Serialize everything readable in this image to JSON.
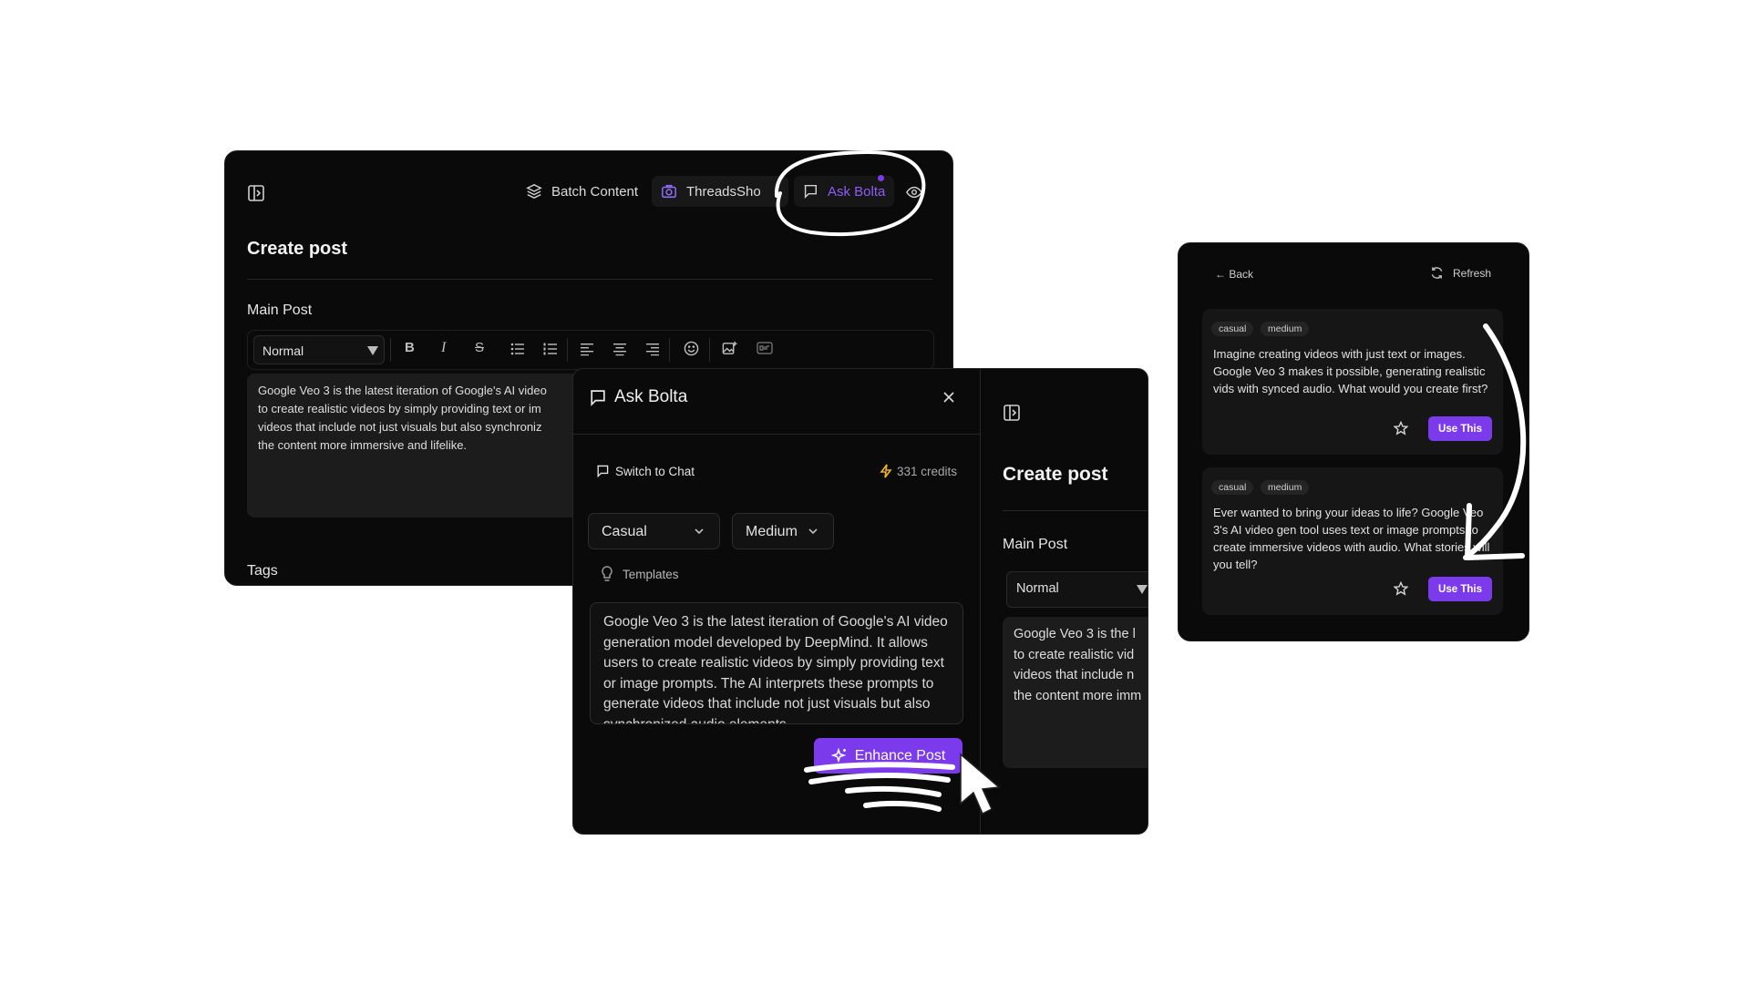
{
  "editor": {
    "header": {
      "batch_content": "Batch Content",
      "threadsshot": "ThreadsSho",
      "ask_bolta": "Ask Bolta"
    },
    "title": "Create post",
    "main_post_label": "Main Post",
    "format_select": "Normal",
    "content_lines": [
      "Google Veo 3 is the latest iteration of Google's AI video",
      "to create realistic videos by simply providing text or im",
      "videos that include not just visuals but also synchroniz",
      "the content more immersive and lifelike."
    ],
    "tags_label": "Tags"
  },
  "ask_bolta": {
    "title": "Ask Bolta",
    "switch_to_chat": "Switch to Chat",
    "credits": "331 credits",
    "tone": "Casual",
    "length": "Medium",
    "templates": "Templates",
    "prompt_text": "Google Veo 3 is the latest iteration of Google's AI video generation model developed by DeepMind. It allows users to create realistic videos by simply providing text or image prompts. The AI interprets these prompts to generate videos that include not just visuals but also synchronized audio elements",
    "enhance_button": "Enhance Post",
    "side": {
      "title": "Create post",
      "main_post_label": "Main Post",
      "format_select": "Normal",
      "content_lines": [
        "Google Veo 3 is the l",
        "to create realistic vid",
        "videos that include n",
        "the content more imm"
      ]
    }
  },
  "suggestions": {
    "back": "← Back",
    "refresh": "Refresh",
    "cards": [
      {
        "tags": [
          "casual",
          "medium"
        ],
        "text": "Imagine creating videos with just text or images. Google Veo 3 makes it possible, generating realistic vids with synced audio. What would you create first?",
        "use_label": "Use This"
      },
      {
        "tags": [
          "casual",
          "medium"
        ],
        "text": "Ever wanted to bring your ideas to life? Google Veo 3's AI video gen tool uses text or image prompts to create immersive videos with audio. What stories will you tell?",
        "use_label": "Use This"
      }
    ]
  },
  "colors": {
    "accent": "#7c3aed",
    "panel_bg": "#0a0a0a",
    "credits_bolt": "#f5b324"
  }
}
